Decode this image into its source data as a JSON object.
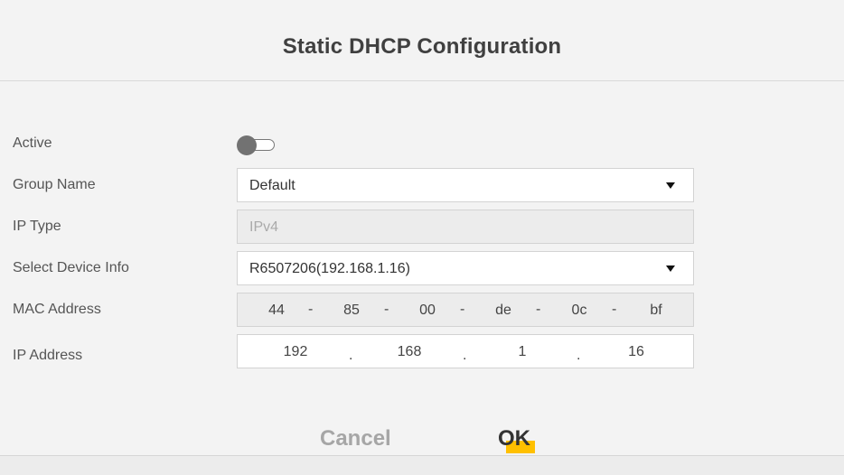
{
  "dialog": {
    "title": "Static DHCP Configuration"
  },
  "labels": {
    "active": "Active",
    "group_name": "Group Name",
    "ip_type": "IP Type",
    "select_device_info": "Select Device Info",
    "mac_address": "MAC Address",
    "ip_address": "IP Address"
  },
  "fields": {
    "active": {
      "state": "off"
    },
    "group_name": {
      "value": "Default"
    },
    "ip_type": {
      "value": "IPv4"
    },
    "device_info": {
      "value": "R6507206(192.168.1.16)"
    },
    "mac": {
      "octets": [
        "44",
        "85",
        "00",
        "de",
        "0c",
        "bf"
      ],
      "separator": "-"
    },
    "ip": {
      "octets": [
        "192",
        "168",
        "1",
        "16"
      ],
      "separator": "."
    }
  },
  "buttons": {
    "cancel": "Cancel",
    "ok": "OK"
  },
  "colors": {
    "accent": "#ffc000",
    "toggle_knob": "#727272",
    "cancel_text": "#a6a6a6",
    "title_text": "#404040"
  },
  "icons": {
    "dropdown": "caret-down-icon"
  }
}
